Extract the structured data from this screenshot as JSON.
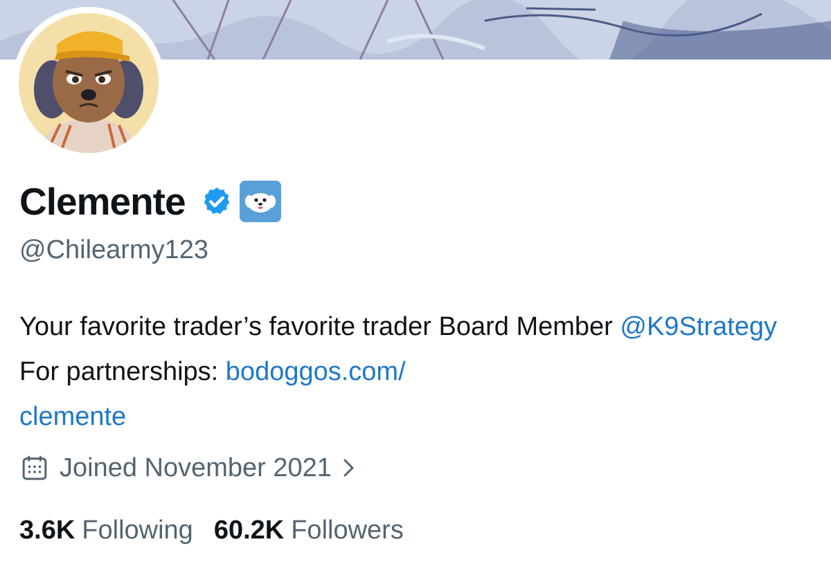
{
  "profile": {
    "display_name": "Clemente",
    "handle": "@Chilearmy123",
    "verified_icon": "verified-badge-icon",
    "affiliate_icon": "dog-affiliate-badge-icon"
  },
  "bio": {
    "text_1": "Your favorite trader’s favorite trader Board Member ",
    "mention": "@K9Strategy",
    "text_2": " For partnerships: ",
    "link_part_1": "bodoggos.com/",
    "link_part_2": "clemente"
  },
  "meta": {
    "joined": "Joined November 2021",
    "calendar_icon": "calendar-icon",
    "chevron_icon": "chevron-right-icon"
  },
  "stats": {
    "following_count": "3.6K",
    "following_label": "Following",
    "followers_count": "60.2K",
    "followers_label": "Followers"
  },
  "colors": {
    "text": "#0f1419",
    "secondary": "#536471",
    "link": "#1d77c9",
    "verified": "#1d9bf0"
  }
}
